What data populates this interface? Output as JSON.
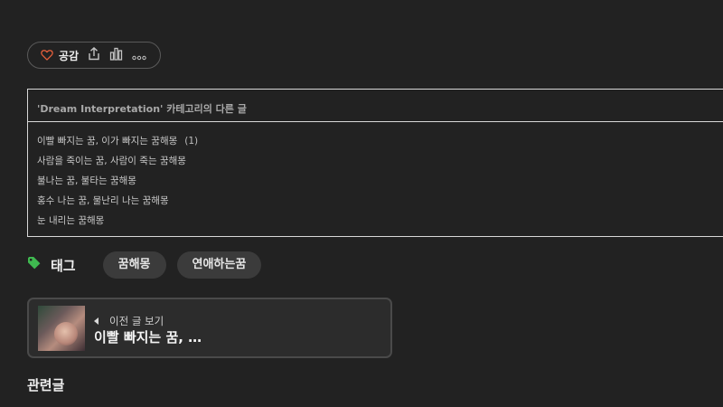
{
  "reactions": {
    "like_label": "공감",
    "icons": [
      "heart-icon",
      "share-icon",
      "stats-icon",
      "more-icon"
    ]
  },
  "category": {
    "title": "'Dream Interpretation' 카테고리의 다른 글",
    "posts": [
      {
        "title": "이빨 빠지는 꿈, 이가 빠지는 꿈해몽",
        "count": "(1)"
      },
      {
        "title": "사람을 죽이는 꿈, 사람이 죽는 꿈해몽",
        "count": ""
      },
      {
        "title": "불나는 꿈, 불타는 꿈해몽",
        "count": ""
      },
      {
        "title": "홍수 나는 꿈, 물난리 나는 꿈해몽",
        "count": ""
      },
      {
        "title": "눈 내리는 꿈해몽",
        "count": ""
      }
    ]
  },
  "tags": {
    "heading": "태그",
    "items": [
      "꿈해몽",
      "연애하는꿈"
    ]
  },
  "prev_post": {
    "label": "이전 글 보기",
    "title": "이빨 빠지는 꿈, …"
  },
  "related": {
    "heading": "관련글"
  },
  "colors": {
    "background": "#222222",
    "tag_icon": "#3fb950",
    "like_heart": "#e8603c",
    "thumbnail_text": "#ff5fb4"
  }
}
